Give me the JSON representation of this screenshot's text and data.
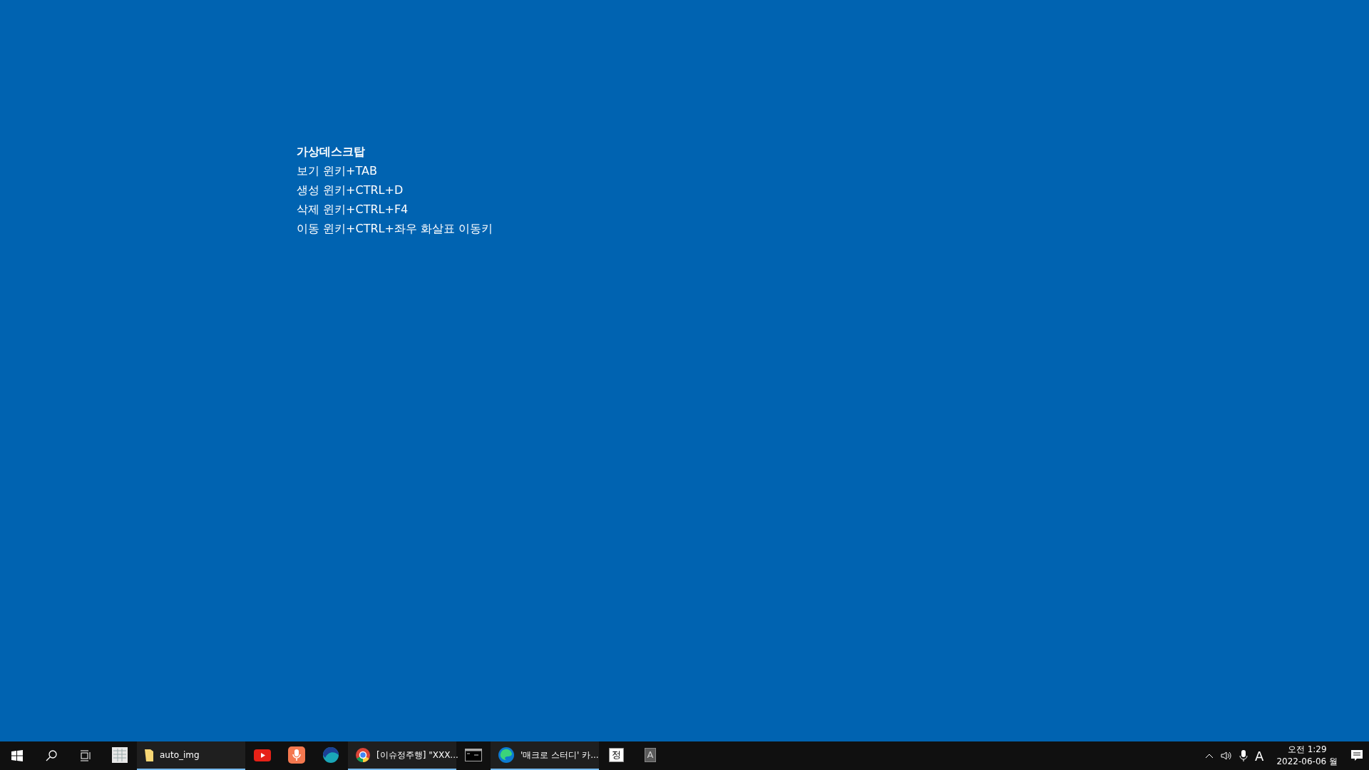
{
  "notes": {
    "title": "가상데스크탑",
    "lines": [
      "보기 윈키+TAB",
      "생성 윈키+CTRL+D",
      "삭제 윈키+CTRL+F4",
      "이동 윈키+CTRL+좌우 화살표 이동키"
    ]
  },
  "taskbar": {
    "apps": [
      {
        "kind": "icon",
        "running": false
      },
      {
        "kind": "window",
        "label": "auto_img",
        "running": true
      },
      {
        "kind": "icon",
        "running": false
      },
      {
        "kind": "icon",
        "running": false
      },
      {
        "kind": "icon",
        "running": false
      },
      {
        "kind": "window",
        "label": "[이슈정주행] \"XXX...",
        "running": true
      },
      {
        "kind": "icon",
        "running": false
      },
      {
        "kind": "window",
        "label": "'매크로 스터디' 카...",
        "running": true
      },
      {
        "kind": "glyph",
        "label": "정",
        "running": false
      },
      {
        "kind": "glyph",
        "label": "A",
        "running": false
      }
    ],
    "input_indicator": "A",
    "time": "오전 1:29",
    "date": "2022-06-06 월"
  }
}
